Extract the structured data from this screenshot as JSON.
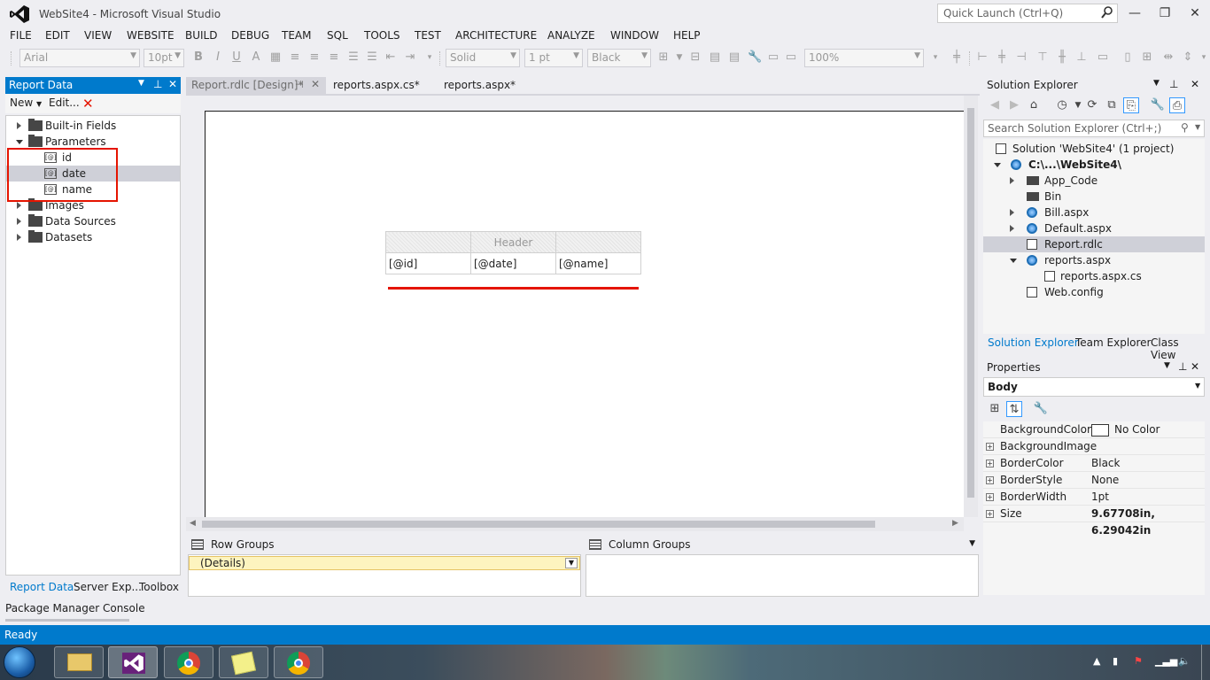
{
  "window": {
    "title": "WebSite4 - Microsoft Visual Studio",
    "quick_launch_placeholder": "Quick Launch (Ctrl+Q)",
    "minimize": "—",
    "restore": "❐",
    "close": "✕"
  },
  "menu": [
    "FILE",
    "EDIT",
    "VIEW",
    "WEBSITE",
    "BUILD",
    "DEBUG",
    "TEAM",
    "SQL",
    "TOOLS",
    "TEST",
    "ARCHITECTURE",
    "ANALYZE",
    "WINDOW",
    "HELP"
  ],
  "toolbar": {
    "font": "Arial",
    "font_size": "10pt",
    "border_style": "Solid",
    "border_width": "1 pt",
    "border_color": "Black",
    "zoom": "100%",
    "bold": "B",
    "italic": "I",
    "underline": "U",
    "font_color": "A"
  },
  "report_data": {
    "title": "Report Data",
    "new_label": "New",
    "edit_label": "Edit...",
    "tree": {
      "builtin": "Built-in Fields",
      "parameters": "Parameters",
      "params": [
        "id",
        "date",
        "name"
      ],
      "param_glyph": "[@]",
      "images": "Images",
      "data_sources": "Data Sources",
      "datasets": "Datasets"
    },
    "bottom_tabs": [
      "Report Data",
      "Server Exp...",
      "Toolbox"
    ]
  },
  "doc_tabs": {
    "design": "Report.rdlc [Design]*",
    "cs": "reports.aspx.cs*",
    "aspx": "reports.aspx*"
  },
  "report_table": {
    "header": "Header",
    "cells": [
      "[@id]",
      "[@date]",
      "[@name]"
    ]
  },
  "groups": {
    "row_title": "Row Groups",
    "col_title": "Column Groups",
    "details": "(Details)"
  },
  "bottom": {
    "pmc": "Package Manager Console",
    "status": "Ready"
  },
  "solution_explorer": {
    "title": "Solution Explorer",
    "search_placeholder": "Search Solution Explorer (Ctrl+;)",
    "solution": "Solution 'WebSite4' (1 project)",
    "project": "C:\\...\\WebSite4\\",
    "items": [
      "App_Code",
      "Bin",
      "Bill.aspx",
      "Default.aspx",
      "Report.rdlc",
      "reports.aspx",
      "reports.aspx.cs",
      "Web.config"
    ],
    "bottom_tabs": [
      "Solution Explorer",
      "Team Explorer",
      "Class View"
    ]
  },
  "properties": {
    "title": "Properties",
    "object": "Body",
    "rows": [
      {
        "name": "BackgroundColor",
        "value": "No Color"
      },
      {
        "name": "BackgroundImage",
        "value": ""
      },
      {
        "name": "BorderColor",
        "value": "Black"
      },
      {
        "name": "BorderStyle",
        "value": "None"
      },
      {
        "name": "BorderWidth",
        "value": "1pt"
      },
      {
        "name": "Size",
        "value": "9.67708in, 6.29042in"
      }
    ]
  },
  "colors": {
    "accent": "#007acc",
    "highlight_red": "#e51400",
    "details_yellow": "#fdf4bf"
  }
}
